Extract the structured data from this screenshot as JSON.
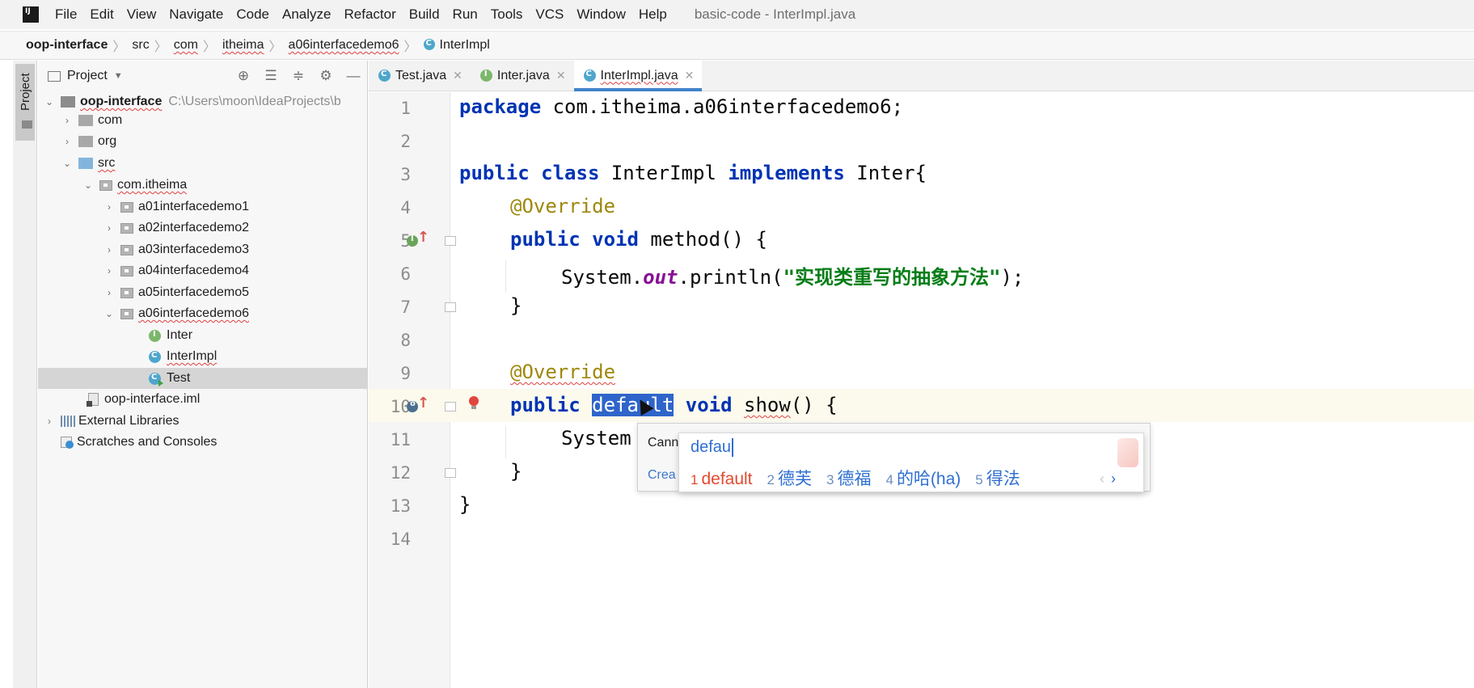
{
  "menubar": {
    "items": [
      "File",
      "Edit",
      "View",
      "Navigate",
      "Code",
      "Analyze",
      "Refactor",
      "Build",
      "Run",
      "Tools",
      "VCS",
      "Window",
      "Help"
    ],
    "window_title": "basic-code - InterImpl.java"
  },
  "breadcrumb": [
    "oop-interface",
    "src",
    "com",
    "itheima",
    "a06interfacedemo6",
    "InterImpl"
  ],
  "sidebar_stripe": {
    "label": "Project"
  },
  "project_panel": {
    "title": "Project",
    "tree": {
      "root_name": "oop-interface",
      "root_path": "C:\\Users\\moon\\IdeaProjects\\b",
      "com": "com",
      "org": "org",
      "src": "src",
      "com_itheima": "com.itheima",
      "packages": [
        "a01interfacedemo1",
        "a02interfacedemo2",
        "a03interfacedemo3",
        "a04interfacedemo4",
        "a05interfacedemo5",
        "a06interfacedemo6"
      ],
      "files": [
        "Inter",
        "InterImpl",
        "Test"
      ],
      "iml": "oop-interface.iml",
      "external_libraries": "External Libraries",
      "scratches": "Scratches and Consoles"
    }
  },
  "tabs": [
    {
      "label": "Test.java",
      "icon": "class-run-icon"
    },
    {
      "label": "Inter.java",
      "icon": "interface-icon"
    },
    {
      "label": "InterImpl.java",
      "icon": "class-icon",
      "active": true
    }
  ],
  "editor": {
    "line_numbers": [
      "1",
      "2",
      "3",
      "4",
      "5",
      "6",
      "7",
      "8",
      "9",
      "10",
      "11",
      "12",
      "13",
      "14"
    ],
    "tokens": {
      "package_kw": "package",
      "package_name": " com.itheima.a06interfacedemo6;",
      "public_kw": "public",
      "class_kw": "class",
      "class_name": " InterImpl ",
      "implements_kw": "implements",
      "iface_name": " Inter{",
      "override": "@Override",
      "void_kw": "void",
      "method_sig": " method() {",
      "system": "System.",
      "out": "out",
      "println_open": ".println(",
      "string_literal": "\"实现类重写的抽象方法\"",
      "println_close": ");",
      "close_brace": "}",
      "default_selected": "default",
      "show_name": "show",
      "show_rest": "() {",
      "system_partial": "System"
    }
  },
  "error_popup": {
    "line1": "Cann",
    "line2": "Crea"
  },
  "ime_popup": {
    "composition": "defau",
    "candidates": [
      {
        "num": "1",
        "text": "default"
      },
      {
        "num": "2",
        "text": "德芙"
      },
      {
        "num": "3",
        "text": "德福"
      },
      {
        "num": "4",
        "text": "的哈(ha)"
      },
      {
        "num": "5",
        "text": "得法"
      }
    ],
    "prev": "‹",
    "next": "›"
  },
  "colors": {
    "keyword": "#0033b3",
    "annotation": "#9e880d",
    "string": "#067d17",
    "field": "#871094",
    "selection": "#2f65ca",
    "active_tab_underline": "#4083c9"
  }
}
